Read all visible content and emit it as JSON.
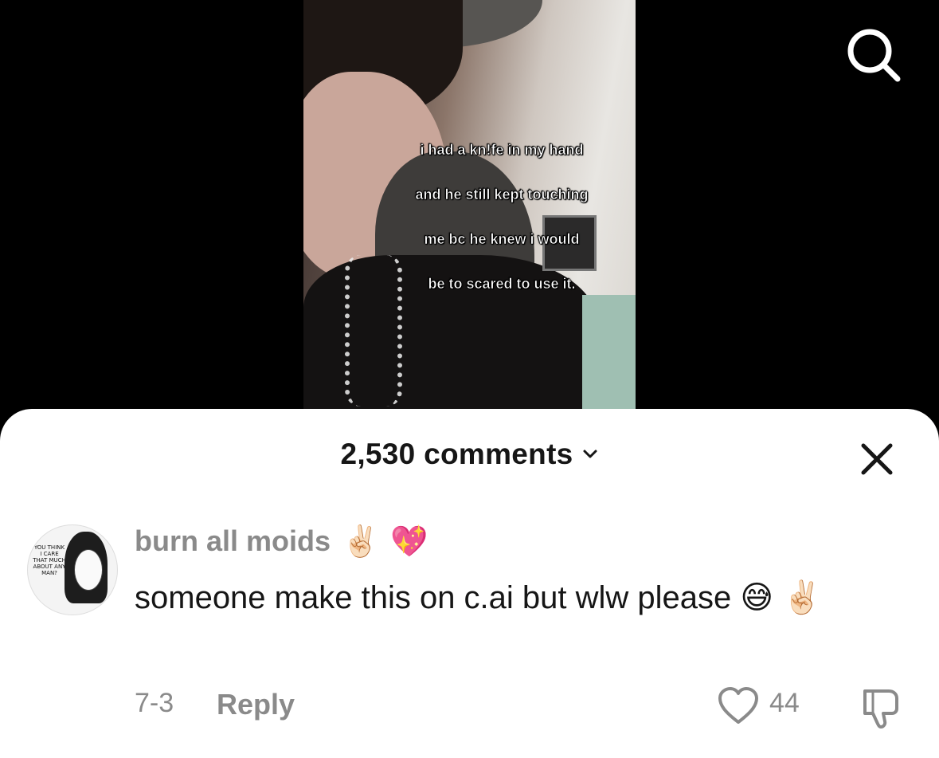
{
  "video": {
    "overlay_lines": [
      "i had a kn!fe in my hand",
      "and he still kept touching",
      "me bc he knew i would",
      "be to scared to use it."
    ]
  },
  "header": {
    "search_icon": "search-icon"
  },
  "comments_sheet": {
    "count_label": "2,530 comments",
    "chevron_icon": "chevron-down-icon",
    "close_icon": "close-icon"
  },
  "comment": {
    "avatar_text": "YOU THINK I CARE THAT MUCH ABOUT ANY MAN?",
    "username": "burn all moids",
    "username_emojis": [
      "✌🏻",
      "💖"
    ],
    "text": "someone make this on c.ai but wlw please 😅 ✌🏻",
    "date": "7-3",
    "reply_label": "Reply",
    "like_icon": "heart-icon",
    "like_count": "44",
    "dislike_icon": "thumbs-down-icon"
  }
}
